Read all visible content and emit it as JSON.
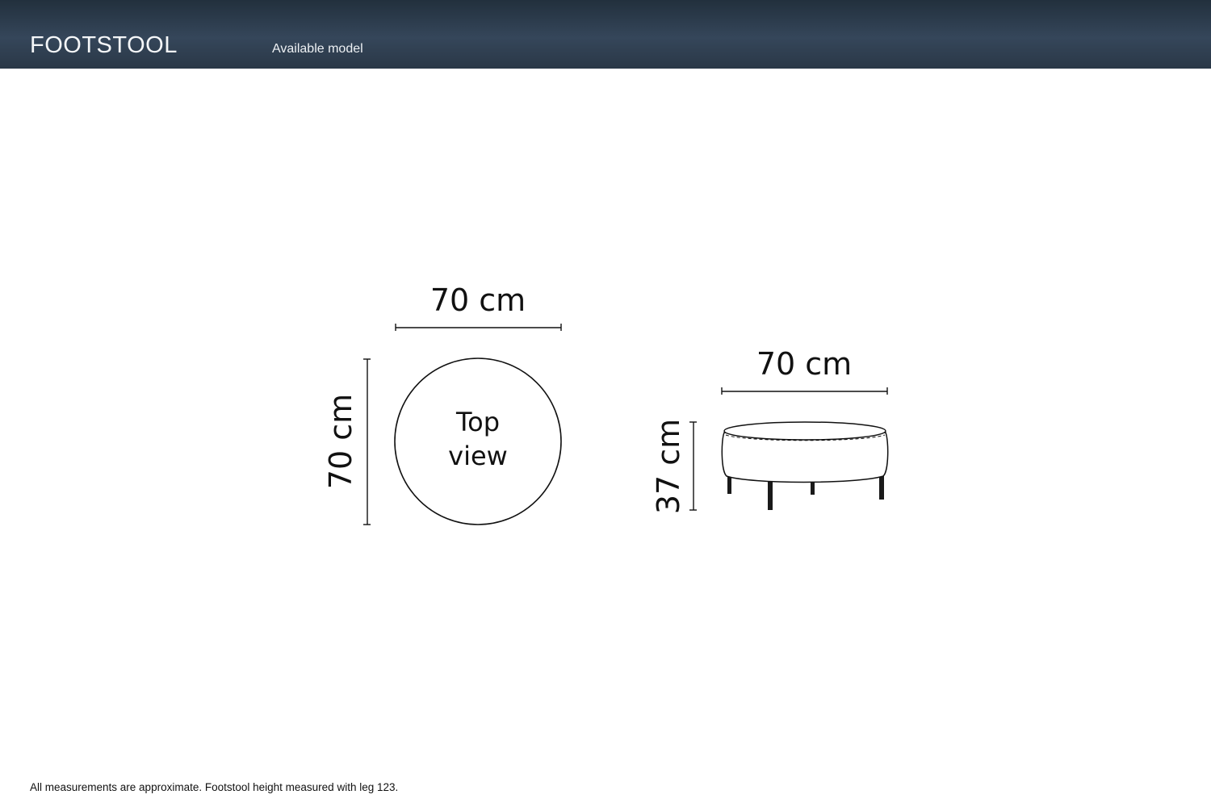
{
  "header": {
    "title": "FOOTSTOOL",
    "subtitle": "Available model"
  },
  "top_view": {
    "width_label": "70 cm",
    "depth_label": "70 cm",
    "label_line1": "Top",
    "label_line2": "view"
  },
  "side_view": {
    "width_label": "70 cm",
    "height_label": "37 cm"
  },
  "footnote": "All measurements are approximate. Footstool height measured with leg 123.",
  "colors": {
    "header_background": "#2e3d4e",
    "line": "#111111"
  }
}
